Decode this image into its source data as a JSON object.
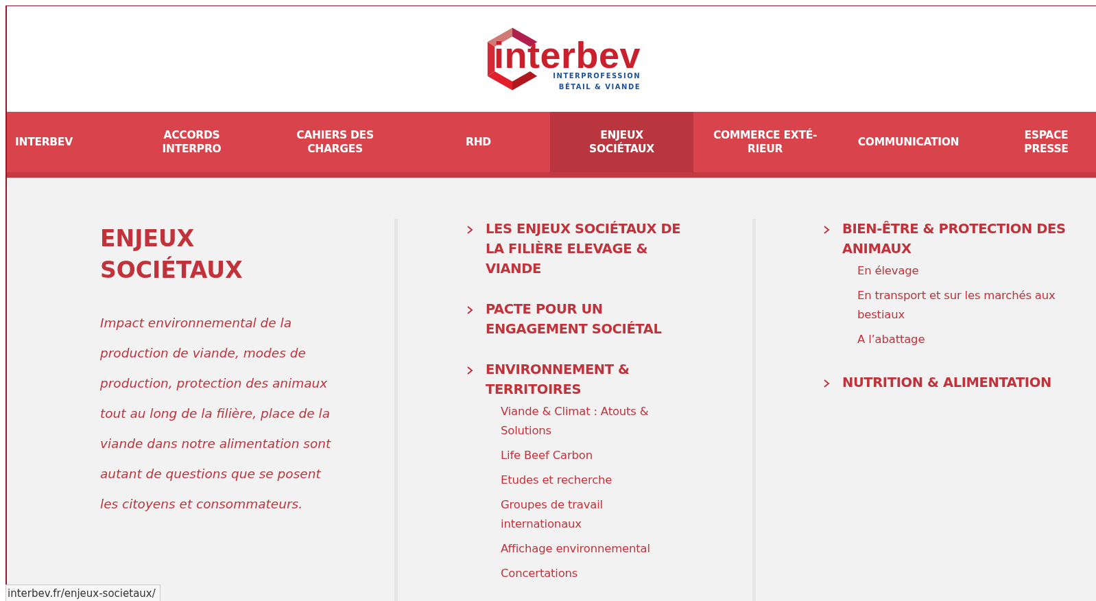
{
  "logo": {
    "name": "interbev",
    "tagline": [
      "INTERPROFESSION",
      "BÉTAIL & VIANDE"
    ]
  },
  "nav": [
    {
      "label": "INTERBEV",
      "selected": false
    },
    {
      "label": "ACCORDS INTERPRO",
      "selected": false
    },
    {
      "label": "CAHIERS DES CHARGES",
      "selected": false
    },
    {
      "label": "RHD",
      "selected": false
    },
    {
      "label": "ENJEUX SOCIÉTAUX",
      "selected": true
    },
    {
      "label": "COMMERCE EXTÉ-RIEUR",
      "selected": false
    },
    {
      "label": "COMMUNICATION",
      "selected": false
    },
    {
      "label": "ESPACE PRESSE",
      "selected": false
    }
  ],
  "section": {
    "title": "ENJEUX SOCIÉTAUX",
    "description": "Impact environnemental de la production de viande, modes de production, protection des animaux tout au long de la filière, place de la viande dans notre alimentation sont autant de questions que se posent les citoyens et consommateurs."
  },
  "menu_columns": [
    [
      {
        "label": "LES ENJEUX SOCIÉTAUX DE LA FILIÈRE ELEVAGE & VIANDE"
      },
      {
        "label": "PACTE POUR UN ENGAGEMENT SOCIÉTAL"
      },
      {
        "label": "ENVIRONNEMENT & TERRITOIRES",
        "children": [
          {
            "label": "Viande & Climat : Atouts & Solutions"
          },
          {
            "label": "Life Beef Carbon"
          },
          {
            "label": "Etudes et recherche"
          },
          {
            "label": "Groupes de travail internationaux"
          },
          {
            "label": "Affichage environnemental"
          },
          {
            "label": "Concertations"
          }
        ]
      }
    ],
    [
      {
        "label": "BIEN-ÊTRE & PROTECTION DES ANIMAUX",
        "children": [
          {
            "label": "En élevage"
          },
          {
            "label": "En transport et sur les marchés aux bestiaux"
          },
          {
            "label": "A l’abattage"
          }
        ]
      },
      {
        "label": "NUTRITION & ALIMENTATION"
      }
    ]
  ],
  "status_bar": {
    "url": "interbev.fr/enjeux-societaux/"
  }
}
